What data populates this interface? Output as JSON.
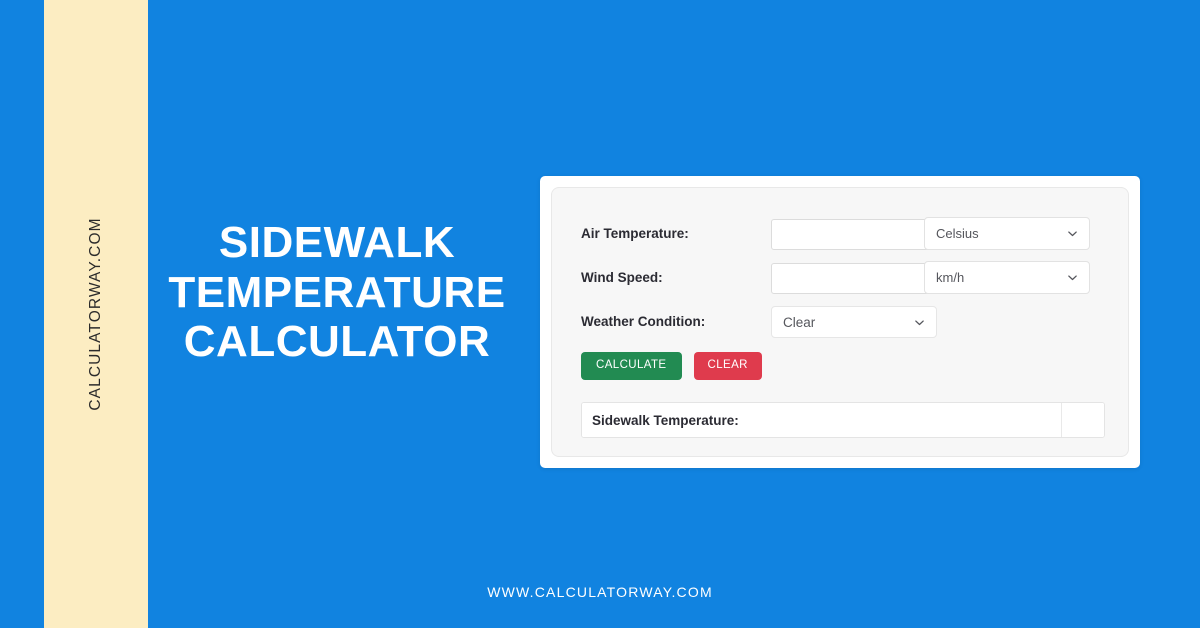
{
  "theme": {
    "background_blue": "#1183e0",
    "band_cream": "#fcedc2",
    "panel_gray": "#f7f7f7",
    "calculate_green": "#228b52",
    "clear_red": "#df3b4d",
    "text_white": "#ffffff"
  },
  "brand": {
    "side_text": "CALCULATORWAY.COM",
    "footer_url": "WWW.CALCULATORWAY.COM"
  },
  "headline": {
    "line1": "SIDEWALK",
    "line2": "TEMPERATURE",
    "line3": "CALCULATOR"
  },
  "calculator": {
    "fields": [
      {
        "label": "Air Temperature:",
        "input_value": "",
        "input_placeholder": "",
        "unit_value": "Celsius"
      },
      {
        "label": "Wind Speed:",
        "input_value": "",
        "input_placeholder": "",
        "unit_value": "km/h"
      },
      {
        "label": "Weather Condition:",
        "select_value": "Clear"
      }
    ],
    "buttons": {
      "calculate": "CALCULATE",
      "clear": "CLEAR"
    },
    "result": {
      "label": "Sidewalk Temperature:",
      "value": "",
      "unit": ""
    }
  },
  "icons": {
    "chevron_down": "chevron-down-icon"
  }
}
